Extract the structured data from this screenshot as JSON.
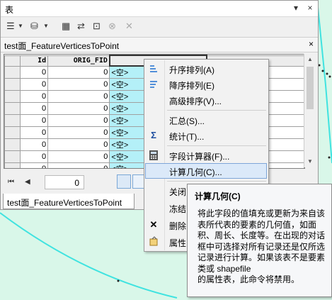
{
  "window": {
    "title": "表",
    "controls": {
      "pin": "▾",
      "close": "×"
    }
  },
  "toolbar": {
    "table_options": "☰",
    "related_tables": "⛁",
    "select_by_attributes": "▦",
    "switch_selection": "⇄",
    "clear_selection": "⊡",
    "zoom_selected": "⊗",
    "delete_selected": "✕"
  },
  "table_tab": {
    "label": "test面_FeatureVerticesToPoint",
    "close": "×"
  },
  "grid": {
    "columns": [
      "Id",
      "ORIG_FID",
      ""
    ],
    "rows": [
      {
        "id": "0",
        "orig_fid": "0",
        "value": "<空>"
      },
      {
        "id": "0",
        "orig_fid": "0",
        "value": "<空>"
      },
      {
        "id": "0",
        "orig_fid": "0",
        "value": "<空>"
      },
      {
        "id": "0",
        "orig_fid": "0",
        "value": "<空>"
      },
      {
        "id": "0",
        "orig_fid": "0",
        "value": "<空>"
      },
      {
        "id": "0",
        "orig_fid": "0",
        "value": "<空>"
      },
      {
        "id": "0",
        "orig_fid": "0",
        "value": "<空>"
      },
      {
        "id": "0",
        "orig_fid": "0",
        "value": "<空>"
      },
      {
        "id": "0",
        "orig_fid": "0",
        "value": "<空>"
      }
    ]
  },
  "navigator": {
    "record": "0",
    "first": "⏮",
    "prev": "◀"
  },
  "bottom_tab": {
    "label": "test面_FeatureVerticesToPoint"
  },
  "context_menu": {
    "items": [
      {
        "label": "升序排列(A)",
        "icon": "sort-ascending-icon"
      },
      {
        "label": "降序排列(E)",
        "icon": "sort-descending-icon"
      },
      {
        "label": "高级排序(V)...",
        "icon": ""
      },
      {
        "label": "汇总(S)...",
        "icon": ""
      },
      {
        "label": "统计(T)...",
        "icon": "sigma-icon",
        "glyph": "Σ"
      },
      {
        "label": "字段计算器(F)...",
        "icon": "calculator-icon"
      },
      {
        "label": "计算几何(C)...",
        "icon": ""
      },
      {
        "label": "关闭",
        "icon": ""
      },
      {
        "label": "冻结",
        "icon": ""
      },
      {
        "label": "删除",
        "icon": "delete-icon",
        "glyph": "✕"
      },
      {
        "label": "属性",
        "icon": "properties-icon"
      }
    ]
  },
  "tooltip": {
    "title": "计算几何(C)",
    "body": "将此字段的值填充或更新为来自该表所代表的要素的几何值，如面积、周长、长度等。在出现的对话框中可选择对所有记录还是仅所选记录进行计算。如果该表不是要素类或 shapefile\n的属性表，此命令将禁用。"
  },
  "colors": {
    "selected_column": "#b4f0f8",
    "map_fill": "#d9f7e9",
    "map_line": "#3fe3e0",
    "menu_highlight": "#dbe9f9"
  }
}
